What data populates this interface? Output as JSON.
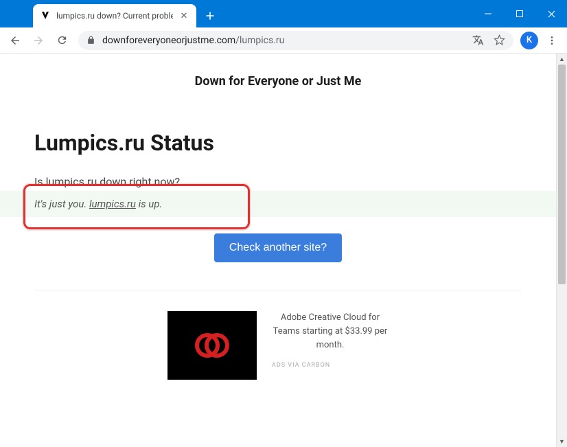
{
  "window": {
    "tab_title": "lumpics.ru down? Current proble",
    "avatar_initial": "K"
  },
  "address": {
    "host": "downforeveryoneorjustme.com",
    "path": "/lumpics.ru"
  },
  "page": {
    "site_name": "Down for Everyone or Just Me",
    "heading": "Lumpics.ru Status",
    "question": "Is lumpics.ru down right now?",
    "answer_prefix": "It's just you. ",
    "answer_site": "lumpics.ru",
    "answer_suffix": " is up.",
    "cta": "Check another site?"
  },
  "ad": {
    "copy": "Adobe Creative Cloud for Teams starting at $33.99 per month.",
    "via": "ADS VIA CARBON"
  }
}
